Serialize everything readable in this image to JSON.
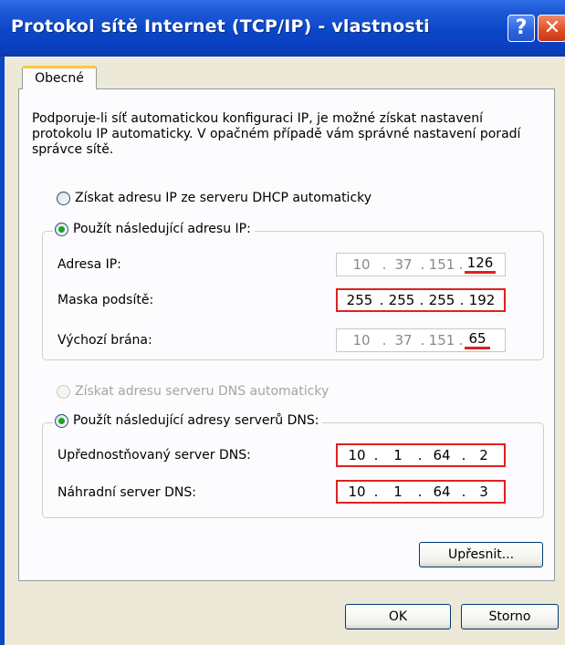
{
  "window": {
    "title": "Protokol sítě Internet (TCP/IP) - vlastnosti",
    "help_label": "?",
    "close_label": "✕"
  },
  "tab": {
    "label": "Obecné"
  },
  "description": "Podporuje-li síť automatickou konfiguraci IP, je možné získat nastavení protokolu IP automaticky. V opačném případě vám správné nastavení poradí správce sítě.",
  "ip_mode": {
    "auto_label": "Získat adresu IP ze serveru DHCP automaticky",
    "manual_label": "Použít následující adresu IP:",
    "selected": "manual"
  },
  "ip_fields": {
    "ip_address": {
      "label": "Adresa IP:",
      "octets": [
        "10",
        "37",
        "151",
        "126"
      ]
    },
    "subnet_mask": {
      "label": "Maska podsítě:",
      "octets": [
        "255",
        "255",
        "255",
        "192"
      ]
    },
    "gateway": {
      "label": "Výchozí brána:",
      "octets": [
        "10",
        "37",
        "151",
        "65"
      ]
    }
  },
  "dns_mode": {
    "auto_label": "Získat adresu serveru DNS automaticky",
    "manual_label": "Použít následující adresy serverů DNS:",
    "selected": "manual"
  },
  "dns_fields": {
    "preferred": {
      "label": "Upřednostňovaný server DNS:",
      "octets": [
        "10",
        "1",
        "64",
        "2"
      ]
    },
    "alternate": {
      "label": "Náhradní server DNS:",
      "octets": [
        "10",
        "1",
        "64",
        "3"
      ]
    }
  },
  "buttons": {
    "advanced": "Upřesnit...",
    "ok": "OK",
    "cancel": "Storno"
  },
  "colors": {
    "titlebar": "#0a46c8",
    "highlight": "#e02020",
    "radio_checked": "#21a121",
    "tab_accent": "#ffc83c"
  }
}
